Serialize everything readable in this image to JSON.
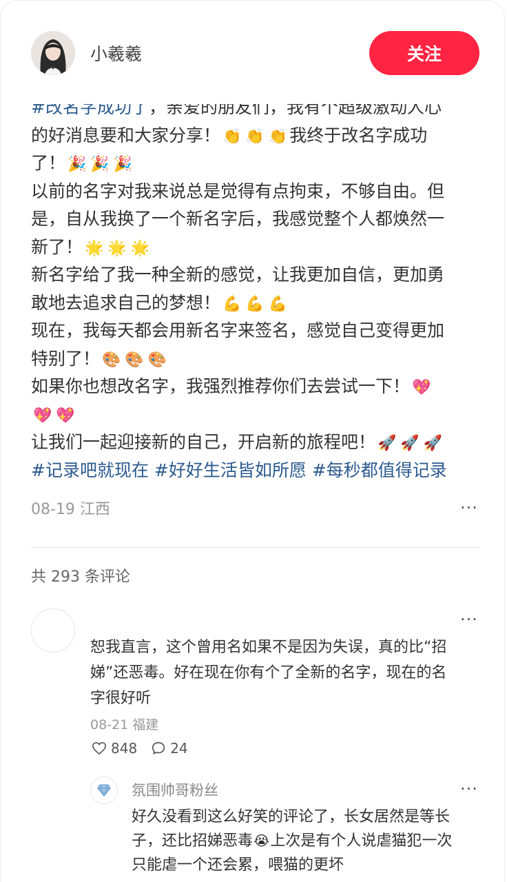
{
  "author": {
    "name": "小羲羲",
    "follow_label": "关注"
  },
  "post": {
    "line0": {
      "tag": "#改名字成功了",
      "text": "，亲爱的朋友们，我有个超级激动人心"
    },
    "line1": {
      "text": "的好消息要和大家分享！",
      "emoji": "👏",
      "tail": "我终于改名字成功"
    },
    "line2": {
      "text": "了！",
      "emoji": "🎉"
    },
    "line3": "以前的名字对我来说总是觉得有点拘束，不够自由。但",
    "line4": "是，自从我换了一个新名字后，我感觉整个人都焕然一",
    "line5": {
      "text": "新了！",
      "emoji": "🌟"
    },
    "line6": "新名字给了我一种全新的感觉，让我更加自信，更加勇",
    "line7": {
      "text": "敢地去追求自己的梦想！",
      "emoji": "💪"
    },
    "line8": "现在，我每天都会用新名字来签名，感觉自己变得更加",
    "line9": {
      "text": "特别了！",
      "emoji": "🎨"
    },
    "line10": {
      "text": "如果你也想改名字，我强烈推荐你们去尝试一下！",
      "emoji": "💖"
    },
    "line11": {
      "emoji": "💖"
    },
    "line12": {
      "text": "让我们一起迎接新的自己，开启新的旅程吧！",
      "emoji": "🚀"
    },
    "tags": [
      "#记录吧就现在",
      "#好好生活皆如所愿",
      "#每秒都值得记录"
    ],
    "date_location": "08-19 江西",
    "more": "···"
  },
  "comments": {
    "count_label": "共 293 条评论",
    "items": [
      {
        "lines": [
          "恕我直言，这个曾用名如果不是因为失误，真的比“招",
          "娣”还恶毒。好在现在你有个了全新的名字，现在的名",
          "字很好听"
        ],
        "date_location": "08-21 福建",
        "likes": "848",
        "replies": "24",
        "more": "···",
        "reply": {
          "name": "氛围帅哥粉丝",
          "lines": [
            "好久没看到这么好笑的评论了，长女居然是等长",
            "子，还比招娣恶毒",
            "上次是有个人说虐猫犯一次",
            "只能虐一个还会累，喂猫的更坏"
          ],
          "emoji": "😭",
          "more": "···"
        }
      }
    ]
  },
  "colors": {
    "accent": "#ff2442",
    "tag": "#2b5a8f",
    "muted": "#999999"
  }
}
